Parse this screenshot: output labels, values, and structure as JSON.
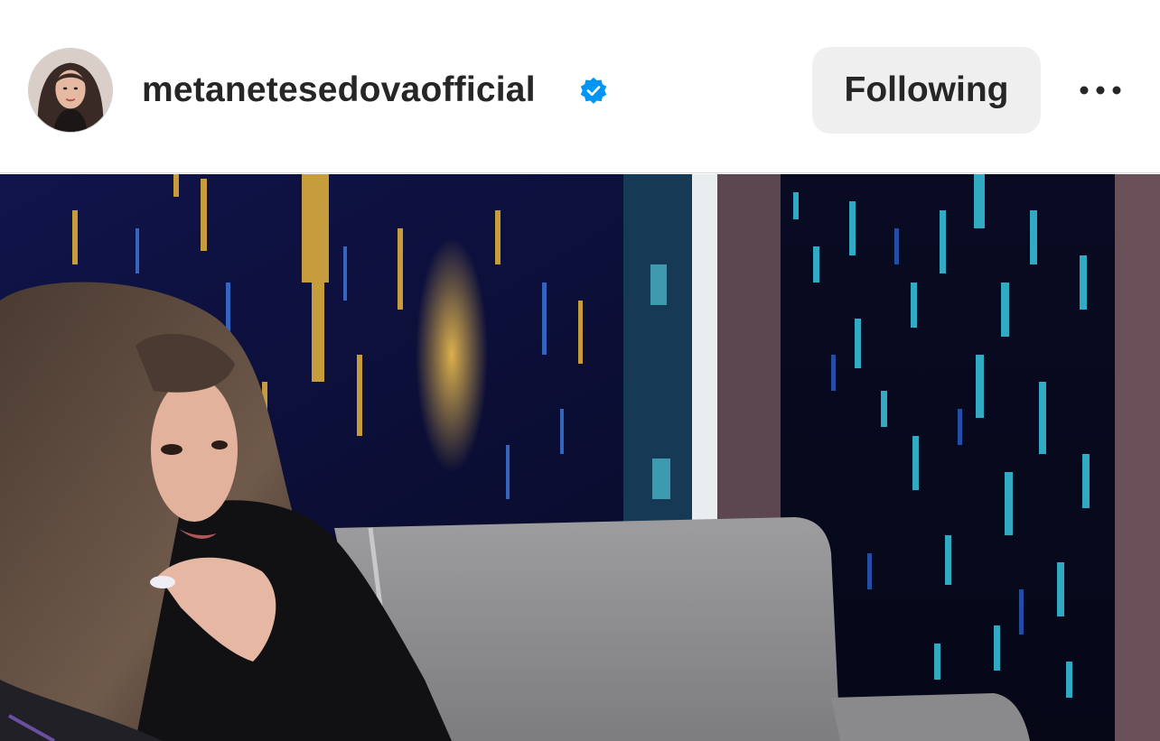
{
  "post": {
    "username": "metanetesedovaofficial",
    "verified": true,
    "follow_label": "Following",
    "more_icon": "more-horizontal-icon",
    "avatar_icon": "profile-avatar",
    "media_description": "photo",
    "colors": {
      "verified_badge": "#0095f6",
      "follow_button_bg": "#efefef",
      "text": "#262626"
    }
  }
}
